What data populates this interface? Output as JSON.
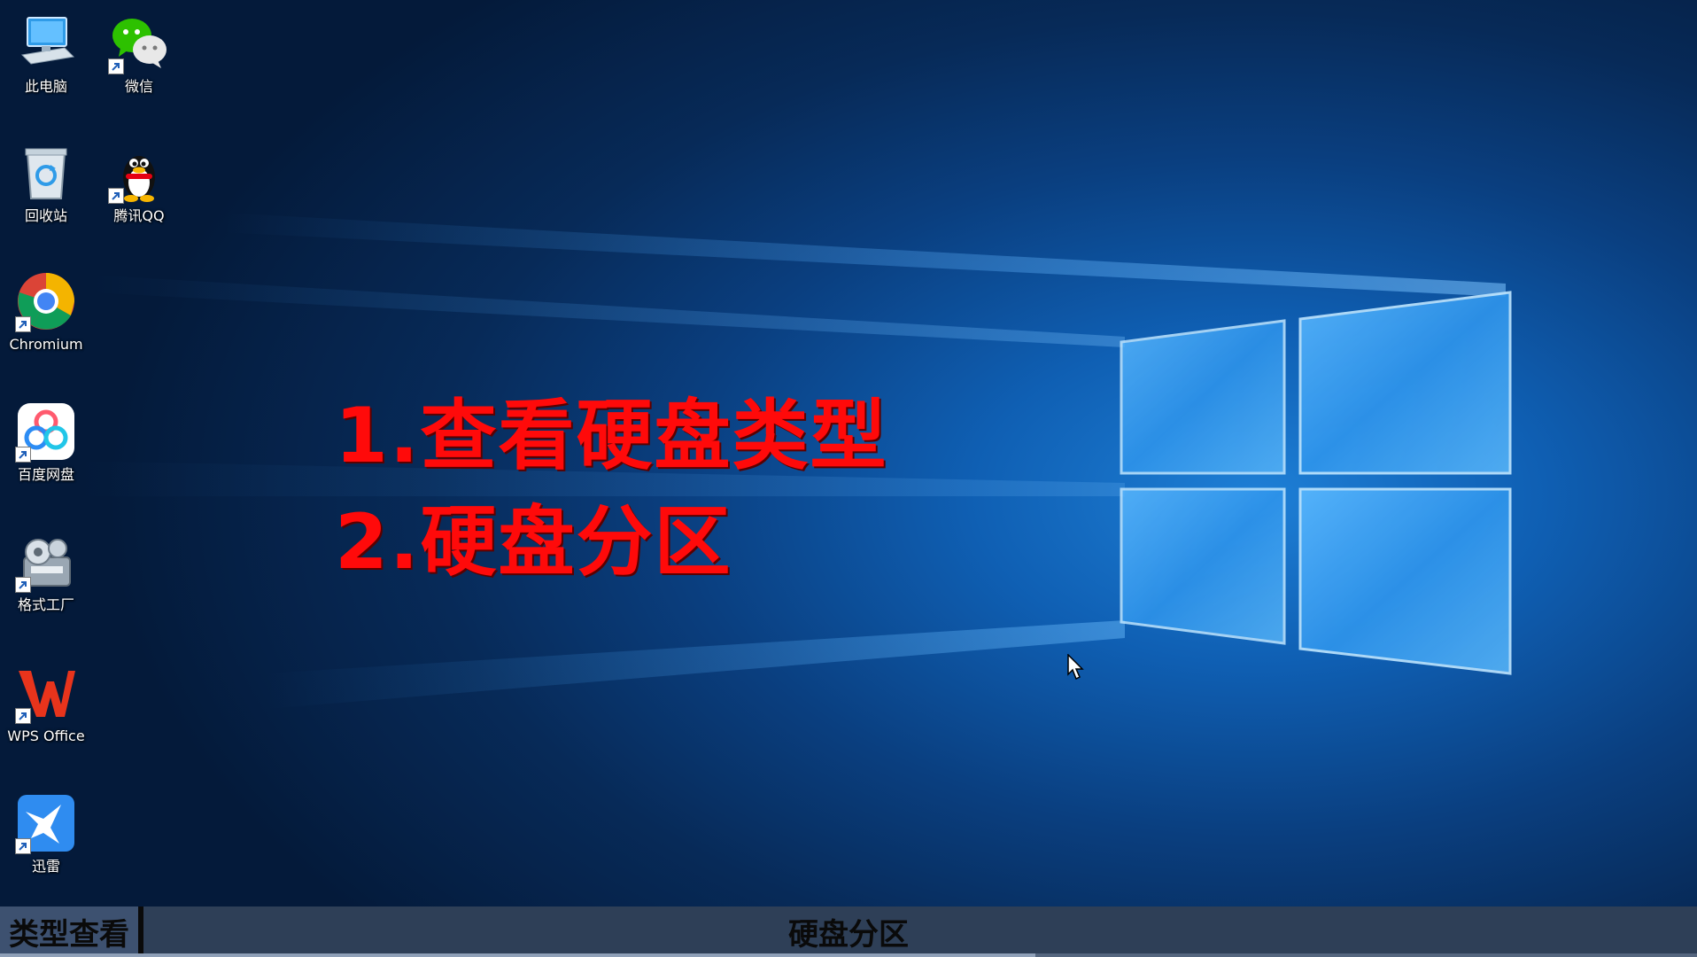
{
  "desktop": {
    "icons": [
      {
        "label": "此电脑",
        "icon": "computer-icon",
        "shortcut": false
      },
      {
        "label": "微信",
        "icon": "wechat-icon",
        "shortcut": true
      },
      {
        "label": "回收站",
        "icon": "recycle-bin-icon",
        "shortcut": false
      },
      {
        "label": "腾讯QQ",
        "icon": "qq-penguin-icon",
        "shortcut": true
      },
      {
        "label": "Chromium",
        "icon": "chromium-icon",
        "shortcut": true
      },
      {
        "label": "百度网盘",
        "icon": "baidu-netdisk-icon",
        "shortcut": true
      },
      {
        "label": "格式工厂",
        "icon": "format-factory-icon",
        "shortcut": true
      },
      {
        "label": "WPS Office",
        "icon": "wps-office-icon",
        "shortcut": true
      },
      {
        "label": "迅雷",
        "icon": "xunlei-icon",
        "shortcut": true
      }
    ]
  },
  "overlay": {
    "line1": "1.查看硬盘类型",
    "line2": "2.硬盘分区"
  },
  "caption_bar": {
    "left": "类型查看",
    "center": "硬盘分区",
    "progress": 0.61
  },
  "colors": {
    "overlay_text": "#ff0a0a",
    "wallpaper_accent": "#1e7fd6",
    "caption_bar": "#2e3f57"
  }
}
